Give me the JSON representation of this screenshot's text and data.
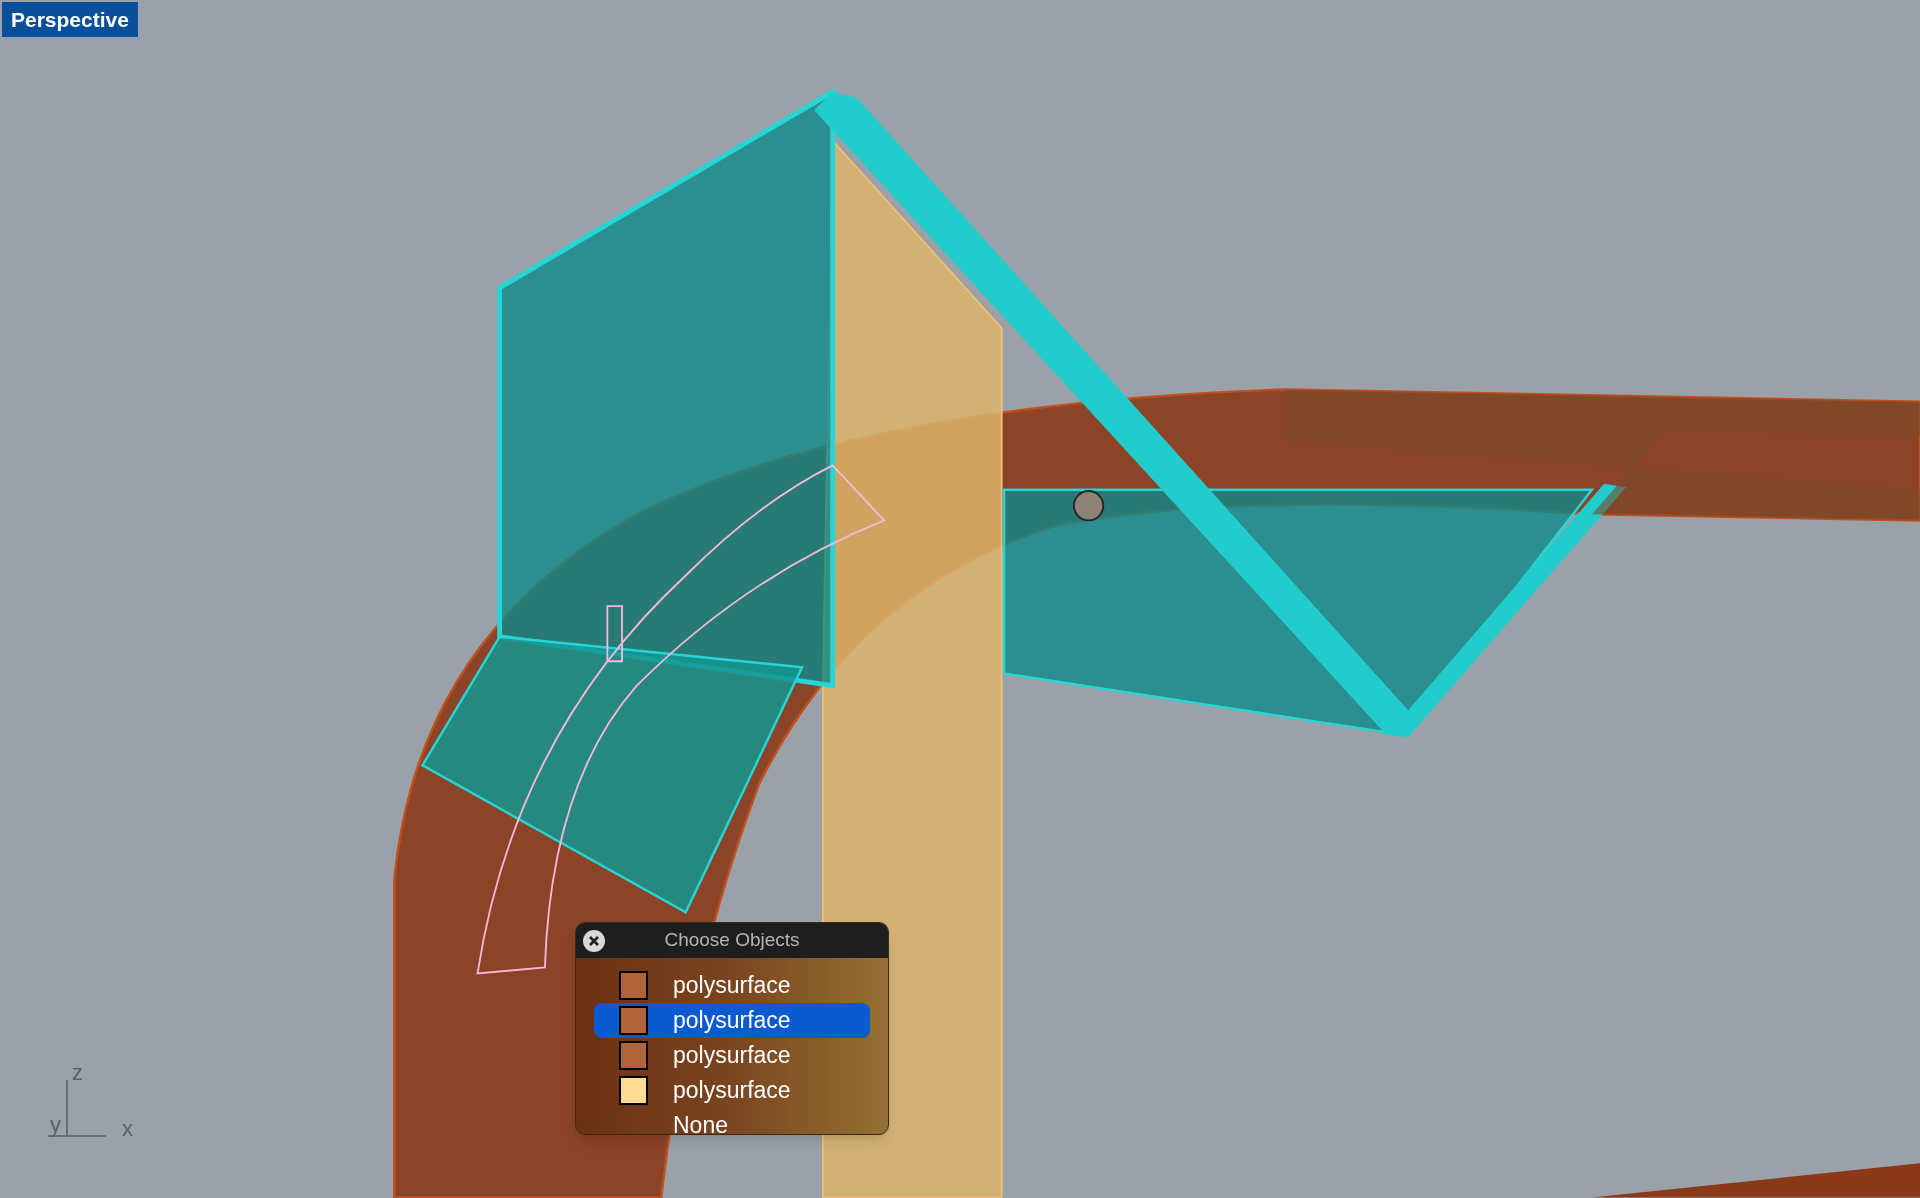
{
  "viewport": {
    "label": "Perspective"
  },
  "axes": {
    "z": "z",
    "y": "y",
    "x": "x"
  },
  "popup": {
    "title": "Choose Objects",
    "items": [
      {
        "label": "polysurface",
        "color": "#b0643c",
        "selected": false
      },
      {
        "label": "polysurface",
        "color": "#b0643c",
        "selected": true
      },
      {
        "label": "polysurface",
        "color": "#b0643c",
        "selected": false
      },
      {
        "label": "polysurface",
        "color": "#ffdb94",
        "selected": false
      },
      {
        "label": "None",
        "selected": false
      }
    ]
  }
}
